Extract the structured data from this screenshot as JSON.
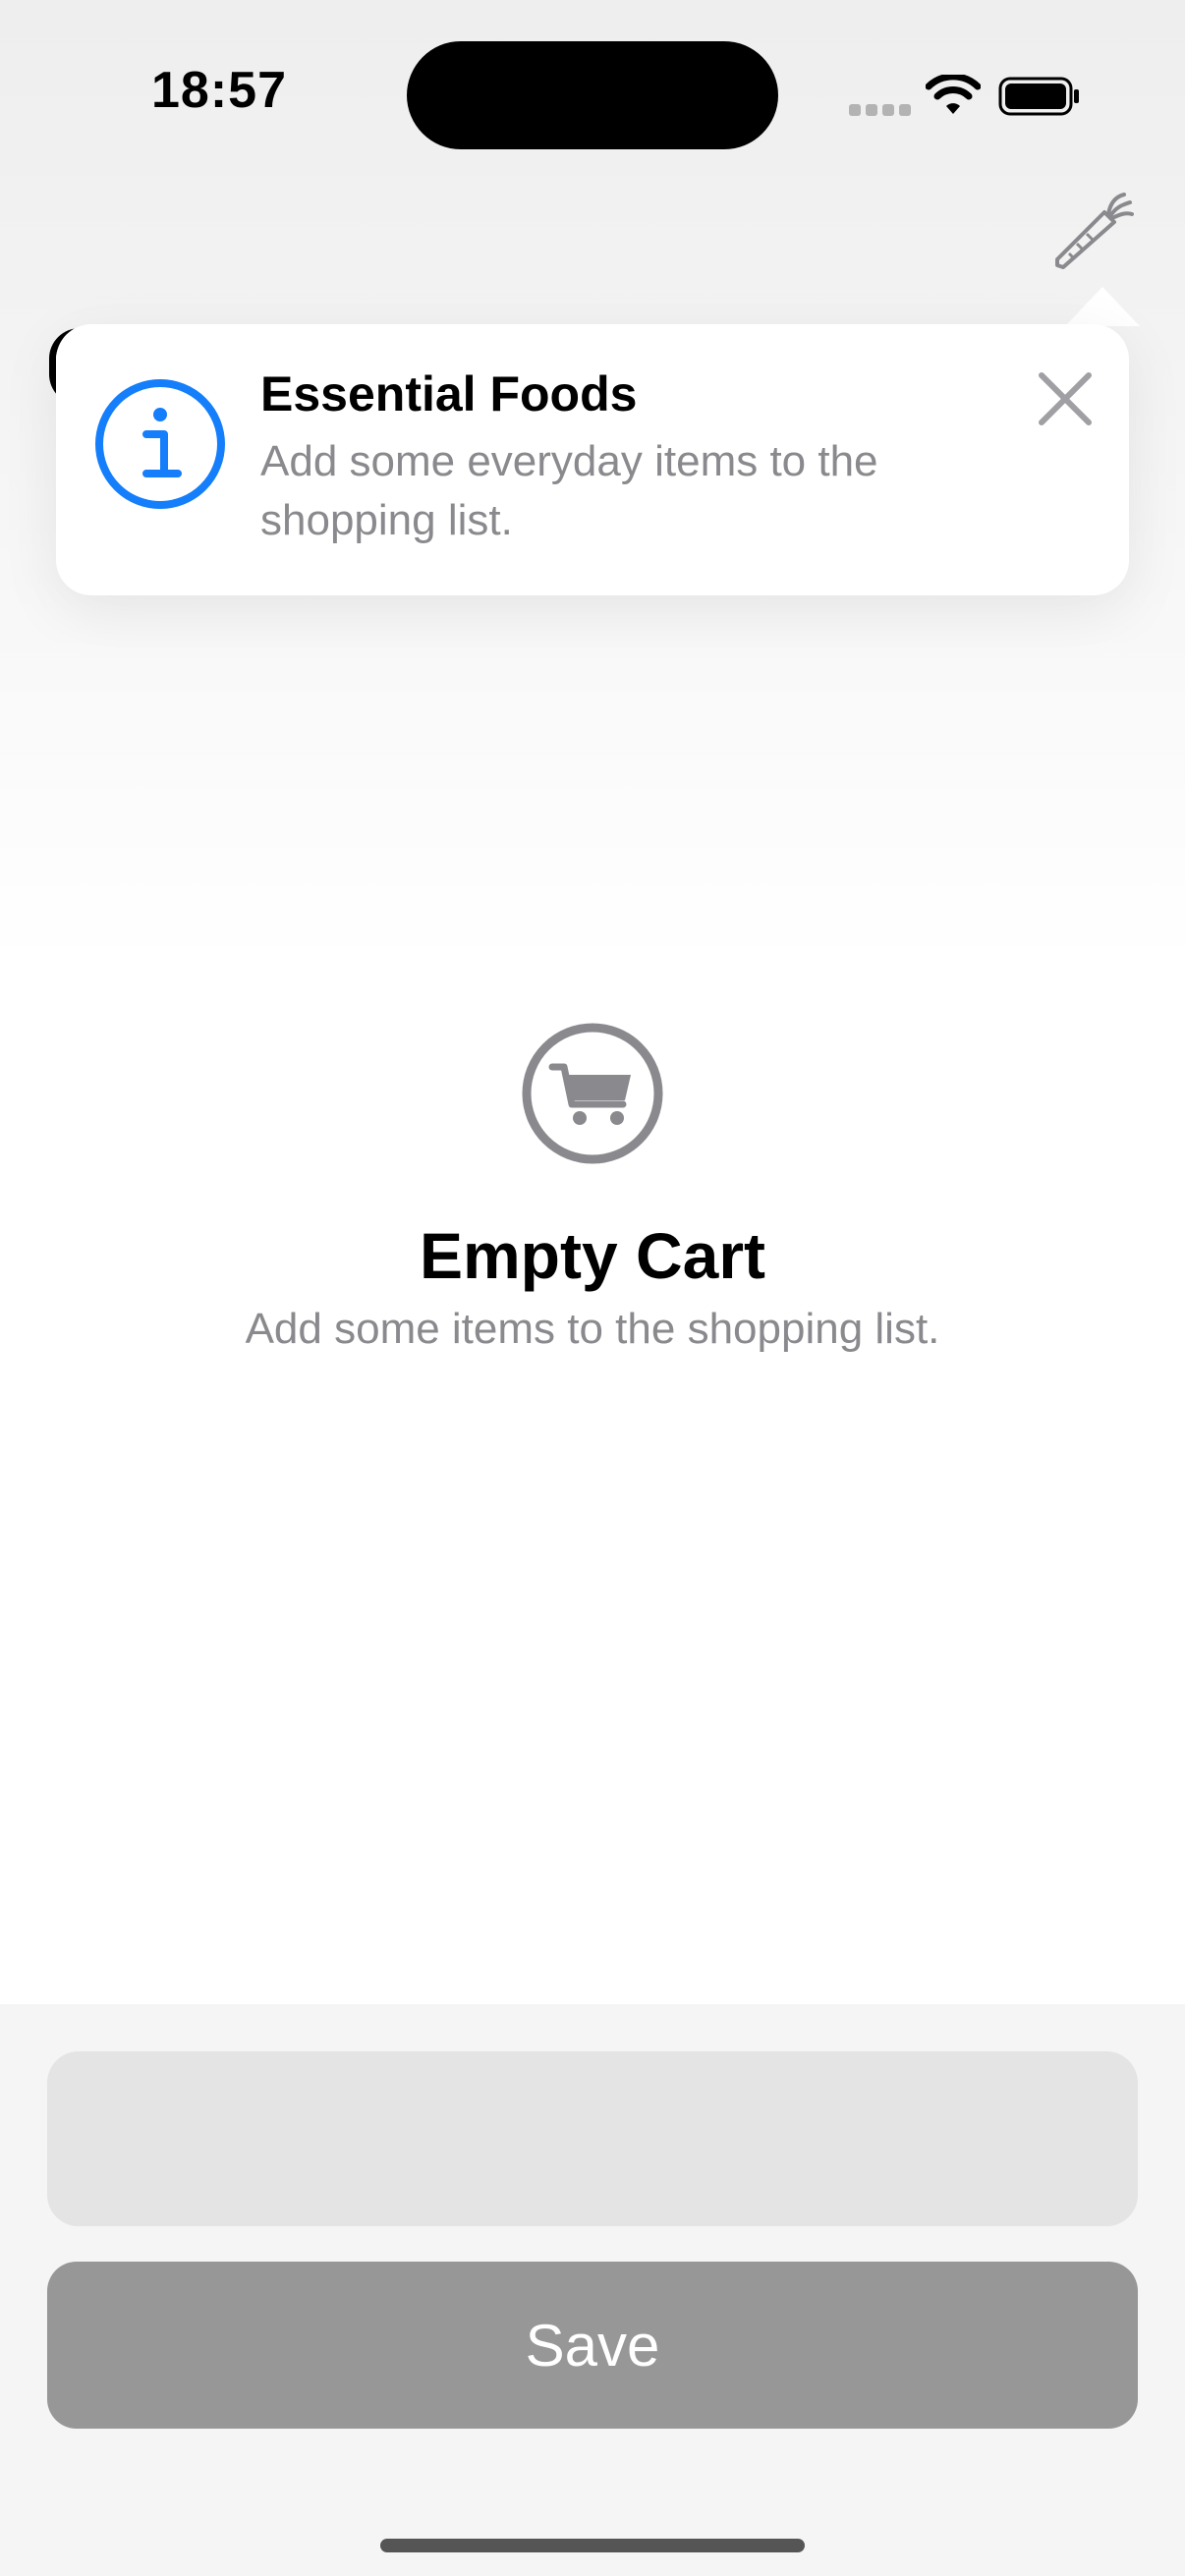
{
  "status_bar": {
    "time": "18:57"
  },
  "nav": {
    "carrot_button_icon": "carrot-icon"
  },
  "popover": {
    "icon": "info-circle-icon",
    "title": "Essential Foods",
    "text": "Add some everyday items to the shopping list.",
    "close_icon": "xmark-icon"
  },
  "empty_state": {
    "icon": "cart-circle-icon",
    "title": "Empty Cart",
    "subtitle": "Add some items to the shopping list."
  },
  "bottom": {
    "input_value": "",
    "save_label": "Save"
  },
  "colors": {
    "accent": "#147EFB",
    "secondary_text": "#8A8A8E",
    "disabled_button": "#979797",
    "input_background": "#E3E4E3"
  }
}
